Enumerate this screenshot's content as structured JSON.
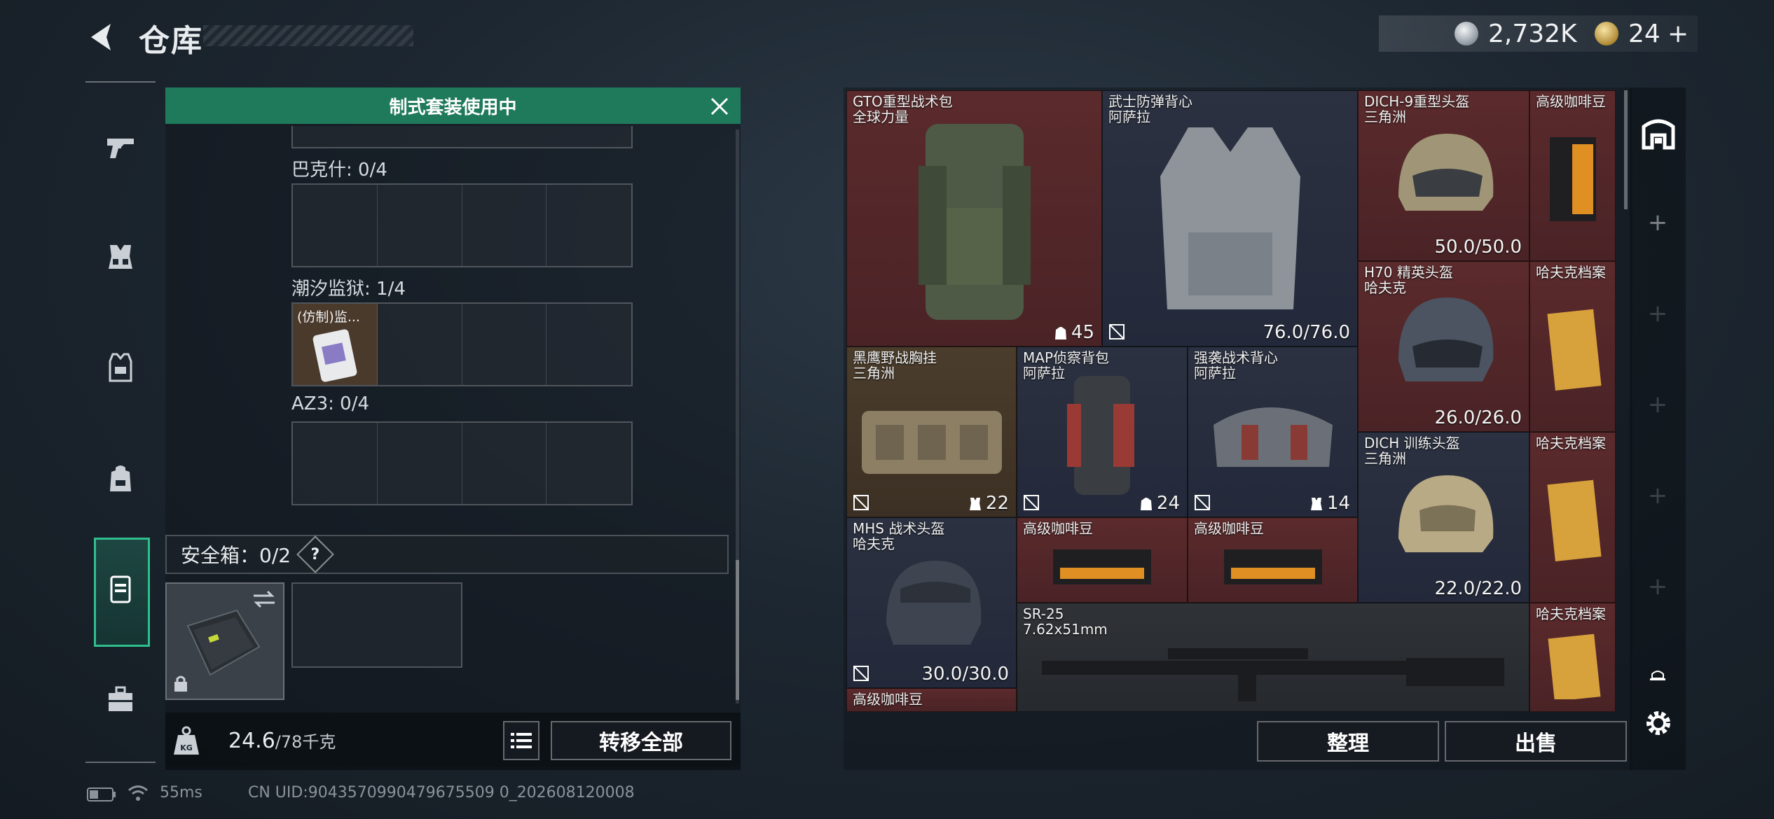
{
  "header": {
    "title": "仓库",
    "currency_silver": "2,732K",
    "currency_gold": "24",
    "add_label": "+"
  },
  "loadout": {
    "banner": "制式套装使用中",
    "sections": [
      {
        "label": "巴克什: 0/4",
        "items": []
      },
      {
        "label": "潮汐监狱: 1/4",
        "items": [
          "(仿制)监..."
        ]
      },
      {
        "label": "AZ3: 0/4",
        "items": []
      }
    ],
    "safe_box_label": "安全箱：0/2",
    "help": "?"
  },
  "footer": {
    "weight_current": "24.6",
    "weight_max": "/78千克",
    "kg_icon_text": "KG",
    "transfer_all": "转移全部"
  },
  "inventory": {
    "items": [
      {
        "name": "GTO重型战术包",
        "sub": "全球力量",
        "value": "45",
        "color": "red"
      },
      {
        "name": "武士防弹背心",
        "sub": "阿萨拉",
        "value": "76.0/76.0",
        "color": "dark"
      },
      {
        "name": "DICH-9重型头盔",
        "sub": "三角洲",
        "value": "50.0/50.0",
        "color": "red"
      },
      {
        "name": "高级咖啡豆",
        "sub": "",
        "value": "",
        "color": "red"
      },
      {
        "name": "H70 精英头盔",
        "sub": "哈夫克",
        "value": "26.0/26.0",
        "color": "red"
      },
      {
        "name": "哈夫克档案",
        "sub": "",
        "value": "",
        "color": "red"
      },
      {
        "name": "黑鹰野战胸挂",
        "sub": "三角洲",
        "value": "22",
        "color": "brown"
      },
      {
        "name": "MAP侦察背包",
        "sub": "阿萨拉",
        "value": "24",
        "color": "dark"
      },
      {
        "name": "强袭战术背心",
        "sub": "阿萨拉",
        "value": "14",
        "color": "dark"
      },
      {
        "name": "DICH 训练头盔",
        "sub": "三角洲",
        "value": "22.0/22.0",
        "color": "dark"
      },
      {
        "name": "哈夫克档案",
        "sub": "",
        "value": "",
        "color": "red"
      },
      {
        "name": "MHS 战术头盔",
        "sub": "哈夫克",
        "value": "30.0/30.0",
        "color": "dark"
      },
      {
        "name": "高级咖啡豆",
        "sub": "",
        "value": "",
        "color": "red"
      },
      {
        "name": "高级咖啡豆",
        "sub": "",
        "value": "",
        "color": "red"
      },
      {
        "name": "SR-25",
        "sub": "7.62x51mm",
        "value": "",
        "color": "plain"
      },
      {
        "name": "哈夫克档案",
        "sub": "",
        "value": "",
        "color": "red"
      },
      {
        "name": "高级咖啡豆",
        "sub": "",
        "value": "",
        "color": "red"
      }
    ],
    "sort_button": "整理",
    "sell_button": "出售"
  },
  "status": {
    "ping": "55ms",
    "uid": "CN UID:9043570990479675509 0_202608120008"
  },
  "colors": {
    "accent_green": "#1f7a5b",
    "item_red": "#5b2a2c",
    "item_dark": "#2b3140",
    "item_brown": "#4b3d2c"
  }
}
